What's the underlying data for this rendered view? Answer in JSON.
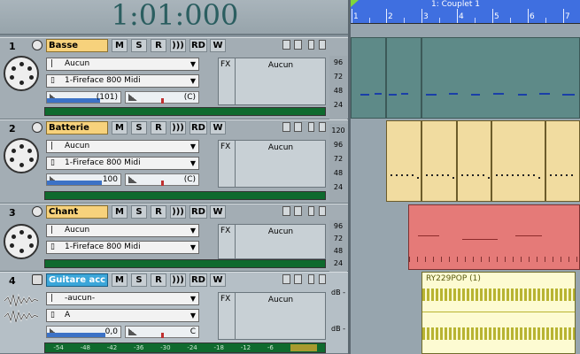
{
  "transport": {
    "time": "1:01:000"
  },
  "ruler": {
    "marker_label": "1: Couplet 1",
    "bars": [
      "1",
      "2",
      "3",
      "4",
      "5",
      "6",
      "7"
    ]
  },
  "tracks": [
    {
      "number": "1",
      "name": "Basse",
      "type": "midi",
      "buttons": {
        "mute": "M",
        "solo": "S",
        "rec": "R",
        "echo": ")))",
        "read": "RD",
        "write": "W"
      },
      "input": "Aucun",
      "output": "1-Fireface 800 Midi",
      "volume": "(101)",
      "pan": "(C)",
      "fx_label": "FX",
      "fx_slot": "Aucun",
      "scale": [
        "96",
        "72",
        "48",
        "24"
      ]
    },
    {
      "number": "2",
      "name": "Batterie",
      "type": "midi",
      "buttons": {
        "mute": "M",
        "solo": "S",
        "rec": "R",
        "echo": ")))",
        "read": "RD",
        "write": "W"
      },
      "input": "Aucun",
      "output": "1-Fireface 800 Midi",
      "volume": "100",
      "pan": "(C)",
      "fx_label": "FX",
      "fx_slot": "Aucun",
      "scale": [
        "120",
        "96",
        "72",
        "48",
        "24"
      ]
    },
    {
      "number": "3",
      "name": "Chant",
      "type": "midi",
      "buttons": {
        "mute": "M",
        "solo": "S",
        "rec": "R",
        "echo": ")))",
        "read": "RD",
        "write": "W"
      },
      "input": "Aucun",
      "output": "1-Fireface 800 Midi",
      "fx_label": "FX",
      "fx_slot": "Aucun",
      "scale": [
        "96",
        "72",
        "48",
        "24"
      ]
    },
    {
      "number": "4",
      "name": "Guitare acc",
      "type": "audio",
      "buttons": {
        "mute": "M",
        "solo": "S",
        "rec": "R",
        "echo": ")))",
        "read": "RD",
        "write": "W"
      },
      "input": "-aucun-",
      "output": "A",
      "volume": "0,0",
      "pan": "C",
      "fx_label": "FX",
      "fx_slot": "Aucun",
      "scale": [
        "dB -",
        "dB -"
      ],
      "meter_scale": [
        "-54",
        "-48",
        "-42",
        "-36",
        "-30",
        "-24",
        "-18",
        "-12",
        "-6"
      ]
    }
  ],
  "clips": {
    "audio_clip_name": "RY229POP (1)"
  },
  "colors": {
    "track_name": "#f7d27c",
    "track_name_selected": "#3ba6d9",
    "bass_clip": "#5e8a88",
    "drum_clip": "#f1dca0",
    "vocal_clip": "#e57a78",
    "audio_clip": "#fdfbd2",
    "ruler": "#3f6fe0"
  }
}
